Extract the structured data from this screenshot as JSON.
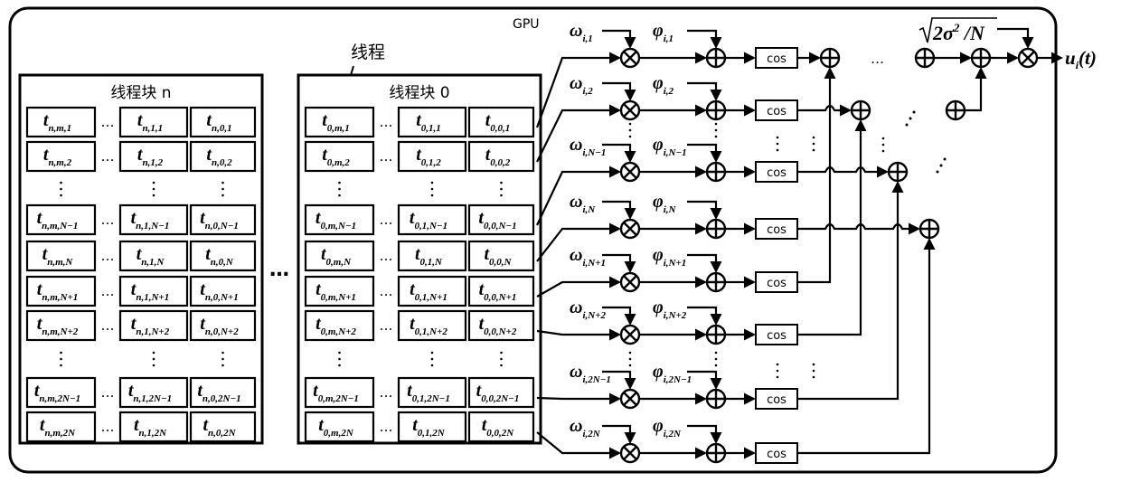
{
  "gpu_label": "GPU",
  "thread_label": "线程",
  "blocks": [
    {
      "title": "线程块 n",
      "block_index": "n",
      "rows": [
        {
          "cells": [
            [
              "n,m,1"
            ],
            [
              "n,1,1"
            ],
            [
              "n,0,1"
            ]
          ]
        },
        {
          "cells": [
            [
              "n,m,2"
            ],
            [
              "n,1,2"
            ],
            [
              "n,0,2"
            ]
          ]
        },
        {
          "dots": true
        },
        {
          "cells": [
            [
              "n,m,N−1"
            ],
            [
              "n,1,N−1"
            ],
            [
              "n,0,N−1"
            ]
          ]
        },
        {
          "cells": [
            [
              "n,m,N"
            ],
            [
              "n,1,N"
            ],
            [
              "n,0,N"
            ]
          ]
        },
        {
          "cells": [
            [
              "n,m,N+1"
            ],
            [
              "n,1,N+1"
            ],
            [
              "n,0,N+1"
            ]
          ]
        },
        {
          "cells": [
            [
              "n,m,N+2"
            ],
            [
              "n,1,N+2"
            ],
            [
              "n,0,N+2"
            ]
          ]
        },
        {
          "dots": true
        },
        {
          "cells": [
            [
              "n,m,2N−1"
            ],
            [
              "n,1,2N−1"
            ],
            [
              "n,0,2N−1"
            ]
          ]
        },
        {
          "cells": [
            [
              "n,m,2N"
            ],
            [
              "n,1,2N"
            ],
            [
              "n,0,2N"
            ]
          ]
        }
      ]
    },
    {
      "title": "线程块 0",
      "block_index": "0",
      "rows": [
        {
          "cells": [
            [
              "0,m,1"
            ],
            [
              "0,1,1"
            ],
            [
              "0,0,1"
            ]
          ]
        },
        {
          "cells": [
            [
              "0,m,2"
            ],
            [
              "0,1,2"
            ],
            [
              "0,0,2"
            ]
          ]
        },
        {
          "dots": true
        },
        {
          "cells": [
            [
              "0,m,N−1"
            ],
            [
              "0,1,N−1"
            ],
            [
              "0,0,N−1"
            ]
          ]
        },
        {
          "cells": [
            [
              "0,m,N"
            ],
            [
              "0,1,N"
            ],
            [
              "0,0,N"
            ]
          ]
        },
        {
          "cells": [
            [
              "0,m,N+1"
            ],
            [
              "0,1,N+1"
            ],
            [
              "0,0,N+1"
            ]
          ]
        },
        {
          "cells": [
            [
              "0,m,N+2"
            ],
            [
              "0,1,N+2"
            ],
            [
              "0,0,N+2"
            ]
          ]
        },
        {
          "dots": true
        },
        {
          "cells": [
            [
              "0,m,2N−1"
            ],
            [
              "0,1,2N−1"
            ],
            [
              "0,0,2N−1"
            ]
          ]
        },
        {
          "cells": [
            [
              "0,m,2N"
            ],
            [
              "0,1,2N"
            ],
            [
              "0,0,2N"
            ]
          ]
        }
      ]
    }
  ],
  "cell_symbol": "t",
  "ellipsis": "…",
  "between_blocks_ellipsis": "…",
  "signal_rows": [
    {
      "omega_sub": "i,1",
      "phi_sub": "i,1",
      "func": "cos"
    },
    {
      "omega_sub": "i,2",
      "phi_sub": "i,2",
      "func": "cos"
    },
    {
      "omega_sub": "i,N−1",
      "phi_sub": "i,N−1",
      "func": "cos"
    },
    {
      "omega_sub": "i,N",
      "phi_sub": "i,N",
      "func": "cos"
    },
    {
      "omega_sub": "i,N+1",
      "phi_sub": "i,N+1",
      "func": "cos"
    },
    {
      "omega_sub": "i,N+2",
      "phi_sub": "i,N+2",
      "func": "cos"
    },
    {
      "omega_sub": "i,2N−1",
      "phi_sub": "i,2N−1",
      "func": "cos"
    },
    {
      "omega_sub": "i,2N",
      "phi_sub": "i,2N",
      "func": "cos"
    }
  ],
  "omega_symbol": "ω",
  "phi_symbol": "φ",
  "scale_factor": "√2σ²/N",
  "scale_factor_parts": {
    "radicand": "2σ",
    "exp": "2",
    "tail": "/N"
  },
  "output_label": {
    "symbol": "u",
    "sub": "i",
    "arg": "(t)"
  },
  "operators": {
    "multiply": "⊗",
    "add": "⊕"
  }
}
